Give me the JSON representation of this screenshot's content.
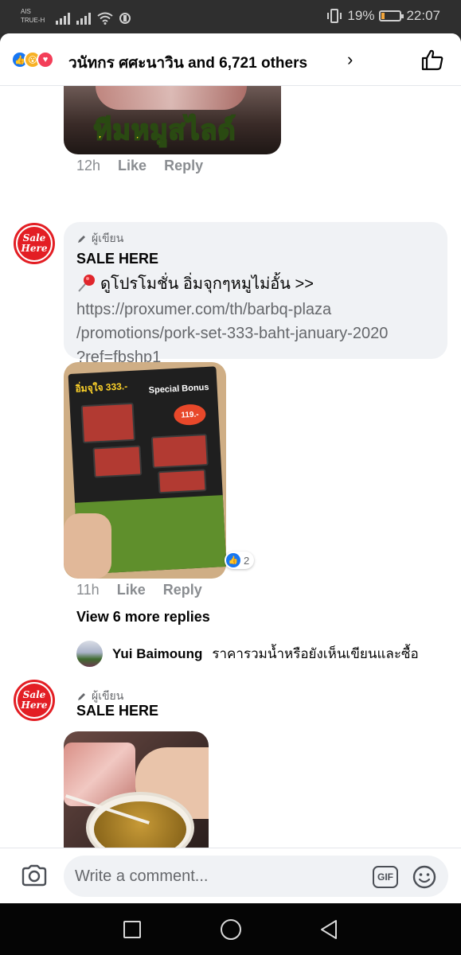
{
  "status_bar": {
    "carrier_line1": "AIS",
    "carrier_line2": "TRUE-H",
    "battery_percent": "19%",
    "battery_level": 0.19,
    "time": "22:07",
    "icons": [
      "signal-icon",
      "signal-icon",
      "wifi-icon",
      "nfc-icon",
      "vibrate-icon",
      "battery-icon"
    ]
  },
  "reactions_header": {
    "reaction_icons": [
      "like-reaction-icon",
      "wow-reaction-icon",
      "love-reaction-icon"
    ],
    "summary": "วนัทกร ศศะนาวิน and 6,721 others",
    "chevron": "›"
  },
  "previous_image": {
    "caption": "ทีมหมูสไลด์"
  },
  "comment1_meta": {
    "time": "12h",
    "like": "Like",
    "reply": "Reply"
  },
  "comment2": {
    "avatar_text_line1": "Sale",
    "avatar_text_line2": "Here",
    "badge": "ผู้เขียน",
    "author": "SALE HERE",
    "text": "ดูโปรโมชั่น อิ่มจุกๆหมูไม่อั้น >>",
    "link_line1": "https://proxumer.com/th/barbq-plaza",
    "link_line2": "/promotions/pork-set-333-baht-january-2020",
    "link_line3": "?ref=fbshp1",
    "image": {
      "title": "อิ่มจุใจ 333.-",
      "bonus": "Special Bonus",
      "price": "119.-"
    },
    "reaction_count": "2",
    "time": "11h",
    "like": "Like",
    "reply": "Reply"
  },
  "replies": {
    "view_more": "View 6 more replies",
    "last_reply_name": "Yui Baimoung",
    "last_reply_text": "ราคารวมน้ำหรือยังเห็นเขียนและซื้อ"
  },
  "comment3": {
    "avatar_text_line1": "Sale",
    "avatar_text_line2": "Here",
    "badge": "ผู้เขียน",
    "author": "SALE HERE"
  },
  "composer": {
    "placeholder": "Write a comment...",
    "gif_label": "GIF"
  },
  "colors": {
    "brand_blue": "#1877f2",
    "sale_red": "#e31e24",
    "secondary_text": "#65676b"
  }
}
